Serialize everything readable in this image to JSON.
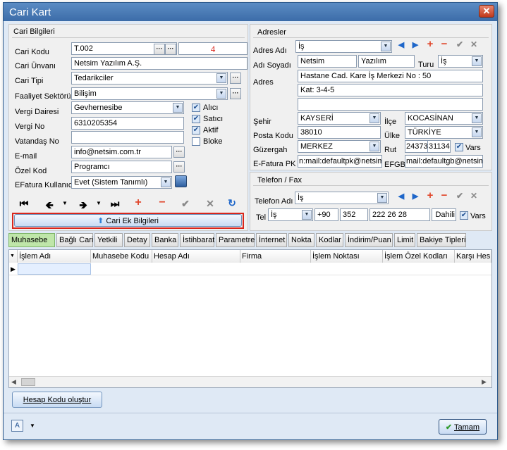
{
  "window": {
    "title": "Cari Kart",
    "close": "✕"
  },
  "cari": {
    "group": "Cari Bilgileri",
    "kod_label": "Cari Kodu",
    "kod": "T.002",
    "kod_note": "4",
    "unvan_label": "Cari Ünvanı",
    "unvan": "Netsim Yazılım A.Ş.",
    "tipi_label": "Cari Tipi",
    "tipi": "Tedarikciler",
    "sektor_label": "Faaliyet Sektörü",
    "sektor": "Bilişim",
    "vd_label": "Vergi Dairesi",
    "vd": "Gevhernesibe",
    "vno_label": "Vergi No",
    "vno": "6310205354",
    "tc_label": "Vatandaş No",
    "tc": "",
    "email_label": "E-mail",
    "email": "info@netsim.com.tr",
    "ozel_label": "Özel Kod",
    "ozel": "Programcı",
    "efatura_label": "EFatura Kullanıcı",
    "efatura": "Evet (Sistem Tanımlı)",
    "flags": {
      "alici": "Alıcı",
      "satici": "Satıcı",
      "aktif": "Aktif",
      "bloke": "Bloke"
    },
    "ek_button": "Cari Ek Bilgileri"
  },
  "adres": {
    "group": "Adresler",
    "adi_label": "Adres Adı",
    "adi": "İş",
    "adsoyad_label": "Adı Soyadı",
    "ad": "Netsim",
    "soyad": "Yazılım",
    "turu_label": "Turu",
    "turu": "İş",
    "adres_label": "Adres",
    "adres1": "Hastane Cad. Kare İş Merkezi No : 50",
    "adres2": "Kat: 3-4-5",
    "adres3": "",
    "sehir_label": "Şehir",
    "sehir": "KAYSERİ",
    "ilce_label": "İlçe",
    "ilce": "KOCASİNAN",
    "posta_label": "Posta Kodu",
    "posta": "38010",
    "ulke_label": "Ülke",
    "ulke": "TÜRKİYE",
    "guzergah_label": "Güzergah",
    "guzergah": "MERKEZ",
    "rut_label": "Rut",
    "rut": "24373",
    "rut2": "31134",
    "vars": "Vars",
    "efpk_label": "E-Fatura PK",
    "efpk": "n:mail:defaultpk@netsim.",
    "efgb_label": "EFGB",
    "efgb": "mail:defaultgb@netsim."
  },
  "tel": {
    "group": "Telefon / Fax",
    "adi_label": "Telefon Adı",
    "adi": "İş",
    "tel_label": "Tel",
    "tip": "İş",
    "ulke": "+90",
    "alan": "352",
    "numara": "222 26 28",
    "dahili": "Dahili",
    "vars": "Vars"
  },
  "tabs": [
    "Muhasebe",
    "Bağlı Cari",
    "Yetkili",
    "Detay",
    "Banka",
    "İstihbarat",
    "Parametre",
    "İnternet",
    "Nokta",
    "Kodlar",
    "İndirim/Puan",
    "Limit",
    "Bakiye Tipleri"
  ],
  "grid": {
    "columns": [
      "İşlem Adı",
      "Muhasebe Kodu",
      "Hesap Adı",
      "Firma",
      "İşlem Noktası",
      "İşlem Özel Kodları",
      "Karşı Hes"
    ]
  },
  "footer": {
    "hesap_button": "Hesap Kodu oluştur",
    "tamam_button": "Tamam"
  },
  "colors": {
    "accent": "#3c6ca8",
    "active_tab": "#bfe6a9",
    "highlight_border": "#d9261c"
  }
}
